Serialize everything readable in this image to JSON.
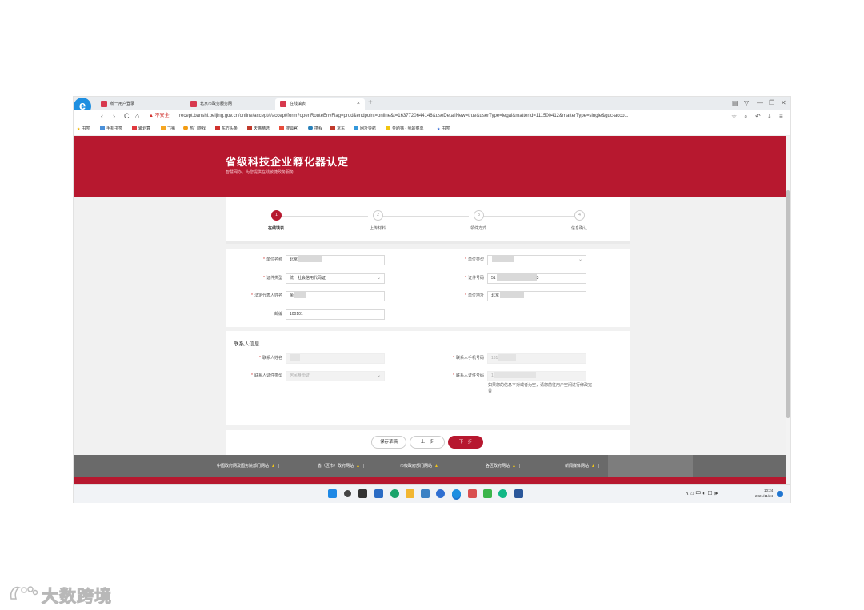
{
  "browser": {
    "tabs": [
      {
        "label": "统一用户登录",
        "active": false
      },
      {
        "label": "北京市政务服务网",
        "active": false
      },
      {
        "label": "在线填表",
        "active": true
      }
    ],
    "new_tab": "+",
    "nav": {
      "back": "‹",
      "forward": "›",
      "reload": "C",
      "home": "⌂"
    },
    "security_warning": "不安全",
    "url": "recept.banshi.beijing.gov.cn/online/accept#/accept/form?openRouteEnvFlag=prod&endpoint=online&t=1637720644146&useDetailNew=true&userType=legal&matterId=111500412&matterType=single&guc-acco...",
    "bookmarks": [
      "书签",
      "手机书签",
      "聚划算",
      "飞猪",
      "热门游戏",
      "东方头条",
      "天猫精选",
      "搜狐官",
      "携程",
      "京东",
      "网址导航",
      "金助猫 - 我的菜单",
      "书签"
    ],
    "window_controls": [
      "▤",
      "▽",
      "—",
      "❐",
      "✕"
    ]
  },
  "page": {
    "title": "省级科技企业孵化器认定",
    "subtitle": "智慧网办，为您提供在线敏捷政务服务",
    "steps": [
      {
        "num": "1",
        "label": "在线填表",
        "active": true
      },
      {
        "num": "2",
        "label": "上传材料",
        "active": false
      },
      {
        "num": "3",
        "label": "领件方式",
        "active": false
      },
      {
        "num": "4",
        "label": "信息确认",
        "active": false
      }
    ],
    "form": {
      "unit_name": {
        "label": "单位名称",
        "value": "北京"
      },
      "unit_type": {
        "label": "单位类型",
        "value": ""
      },
      "id_type": {
        "label": "证件类型",
        "value": "统一社会信用代码证"
      },
      "id_number": {
        "label": "证件号码",
        "value_start": "51",
        "value_end": "3"
      },
      "legal_rep": {
        "label": "法定代表人姓名",
        "value": "余"
      },
      "address": {
        "label": "单位地址",
        "value": "北京"
      },
      "postcode": {
        "label": "邮编",
        "value": "100101"
      }
    },
    "contact": {
      "section_title": "联系人信息",
      "name": {
        "label": "联系人姓名",
        "value": ""
      },
      "phone": {
        "label": "联系人手机号码",
        "value": "131"
      },
      "id_type": {
        "label": "联系人证件类型",
        "value": "居民身份证"
      },
      "id_number": {
        "label": "联系人证件号码",
        "value": "1"
      },
      "note": "如果您的信息不对或者为空，请您前往用户空间进行修改完善"
    },
    "buttons": {
      "save_draft": "保存草稿",
      "prev": "上一步",
      "next": "下一步"
    },
    "footer_links": [
      "中国政府网及国务院部门网站",
      "省（区市）政府网站",
      "市级政府部门网站",
      "各区政府网站",
      "新闻媒体网站"
    ]
  },
  "taskbar": {
    "tray": "∧ ⌂ 中 ◐ ☐ 🕪",
    "time": "10:24",
    "date": "2021/11/24"
  },
  "watermark": "大数跨境",
  "colors": {
    "brand_red": "#b7182f",
    "footer_gray": "#6a6a6a"
  }
}
